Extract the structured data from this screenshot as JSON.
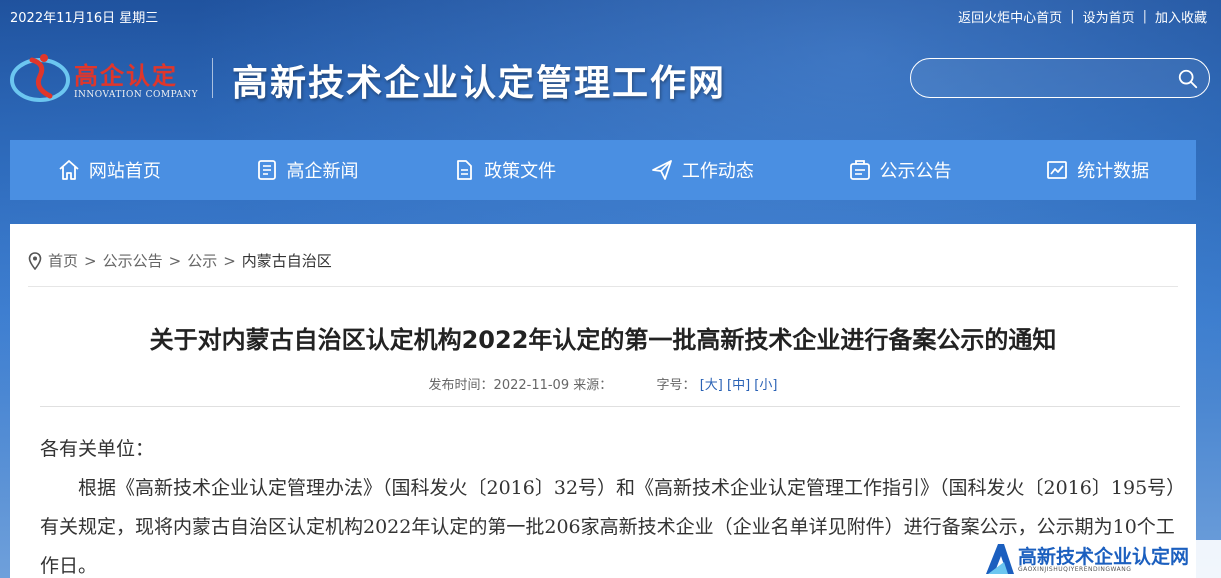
{
  "topbar": {
    "date": "2022年11月16日 星期三",
    "links": [
      "返回火炬中心首页",
      "设为首页",
      "加入收藏"
    ]
  },
  "header": {
    "logo_text": "高企认定",
    "logo_sub": "INNOVATION COMPANY",
    "site_title": "高新技术企业认定管理工作网",
    "search_placeholder": ""
  },
  "nav": {
    "items": [
      {
        "label": "网站首页",
        "icon": "home-icon"
      },
      {
        "label": "高企新闻",
        "icon": "news-icon"
      },
      {
        "label": "政策文件",
        "icon": "document-icon"
      },
      {
        "label": "工作动态",
        "icon": "send-icon"
      },
      {
        "label": "公示公告",
        "icon": "notice-icon"
      },
      {
        "label": "统计数据",
        "icon": "chart-icon"
      }
    ]
  },
  "breadcrumb": {
    "items": [
      "首页",
      "公示公告",
      "公示"
    ],
    "current": "内蒙古自治区",
    "separator": ">"
  },
  "article": {
    "title": "关于对内蒙古自治区认定机构2022年认定的第一批高新技术企业进行备案公示的通知",
    "meta_prefix": "发布时间：",
    "date": "2022-11-09",
    "source_label": "来源：",
    "font_label": "字号：",
    "size_large": "[大]",
    "size_medium": "[中]",
    "size_small": "[小]",
    "salutation": "各有关单位：",
    "paragraph": "根据《高新技术企业认定管理办法》（国科发火〔2016〕32号）和《高新技术企业认定管理工作指引》（国科发火〔2016〕195号）有关规定，现将内蒙古自治区认定机构2022年认定的第一批206家高新技术企业（企业名单详见附件）进行备案公示，公示期为10个工作日。"
  },
  "watermark": {
    "text": "高新技术企业认定网",
    "sub": "GAOXINJISHUQIYERENDINGWANG"
  }
}
